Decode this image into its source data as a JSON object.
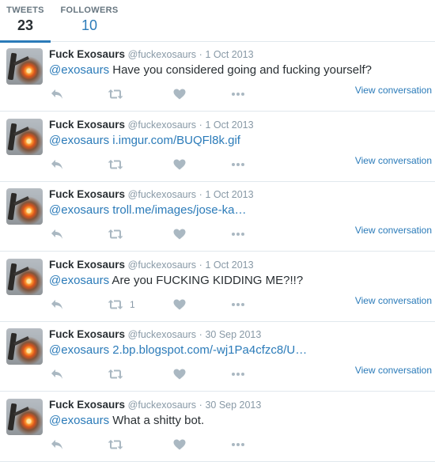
{
  "stats": {
    "tweets_label": "TWEETS",
    "tweets_value": "23",
    "followers_label": "FOLLOWERS",
    "followers_value": "10"
  },
  "colors": {
    "accent": "#2b7bb9",
    "muted": "#8899a6",
    "icon": "#aab8c2",
    "border": "#e1e8ed"
  },
  "tweets": [
    {
      "name": "Fuck Exosaurs",
      "handle": "@fuckexosaurs",
      "sep": "·",
      "date": "1 Oct 2013",
      "mention": "@exosaurs",
      "body": " Have you considered going and fucking yourself?",
      "body_is_link": false,
      "retweets": "",
      "view": "View conversation"
    },
    {
      "name": "Fuck Exosaurs",
      "handle": "@fuckexosaurs",
      "sep": "·",
      "date": "1 Oct 2013",
      "mention": "@exosaurs",
      "body": " i.imgur.com/BUQFl8k.gif",
      "body_is_link": true,
      "retweets": "",
      "view": "View conversation"
    },
    {
      "name": "Fuck Exosaurs",
      "handle": "@fuckexosaurs",
      "sep": "·",
      "date": "1 Oct 2013",
      "mention": "@exosaurs",
      "body": " troll.me/images/jose-ka…",
      "body_is_link": true,
      "retweets": "",
      "view": "View conversation"
    },
    {
      "name": "Fuck Exosaurs",
      "handle": "@fuckexosaurs",
      "sep": "·",
      "date": "1 Oct 2013",
      "mention": "@exosaurs",
      "body": " Are you FUCKING KIDDING ME?!!?",
      "body_is_link": false,
      "retweets": "1",
      "view": "View conversation"
    },
    {
      "name": "Fuck Exosaurs",
      "handle": "@fuckexosaurs",
      "sep": "·",
      "date": "30 Sep 2013",
      "mention": "@exosaurs",
      "body": " 2.bp.blogspot.com/-wj1Pa4cfzc8/U…",
      "body_is_link": true,
      "retweets": "",
      "view": "View conversation"
    },
    {
      "name": "Fuck Exosaurs",
      "handle": "@fuckexosaurs",
      "sep": "·",
      "date": "30 Sep 2013",
      "mention": "@exosaurs",
      "body": " What a shitty bot.",
      "body_is_link": false,
      "retweets": "",
      "view": ""
    }
  ],
  "icons": {
    "reply": "reply-icon",
    "retweet": "retweet-icon",
    "like": "heart-icon",
    "more": "more-dots-icon"
  }
}
